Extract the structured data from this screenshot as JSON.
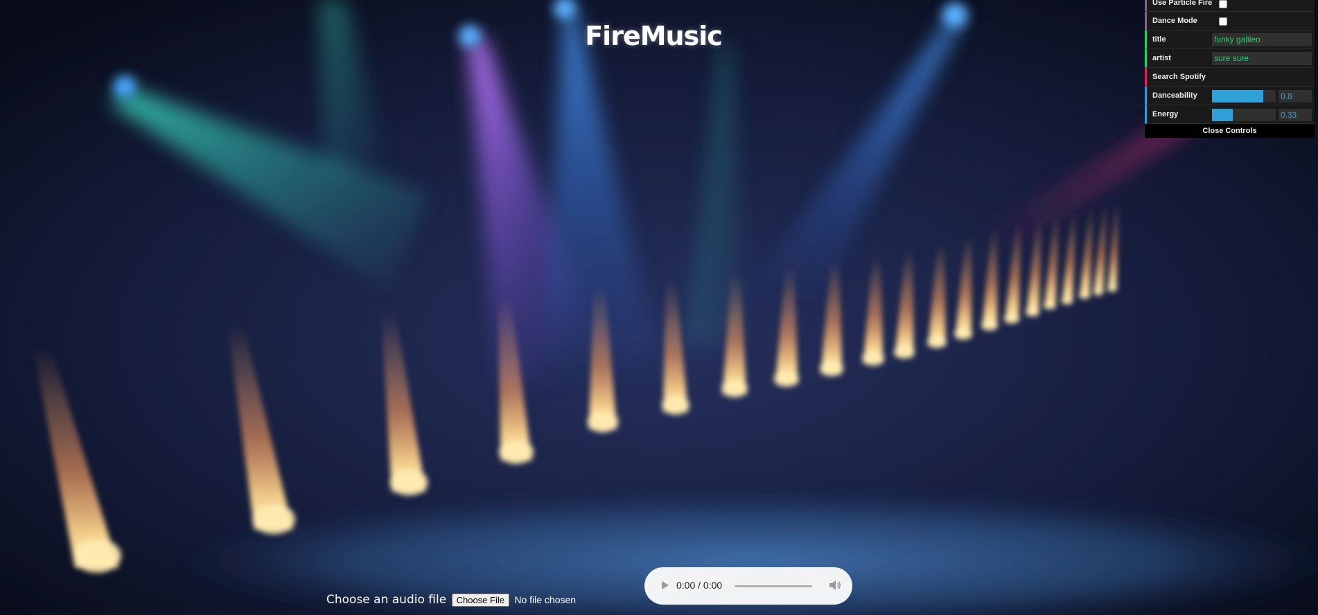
{
  "app": {
    "title": "FireMusic"
  },
  "controls": {
    "use_particle_fire": {
      "label": "Use Particle Fire",
      "checked": false
    },
    "dance_mode": {
      "label": "Dance Mode",
      "checked": false
    },
    "title": {
      "label": "title",
      "value": "funky galileo"
    },
    "artist": {
      "label": "artist",
      "value": "sure sure"
    },
    "search_spotify": {
      "label": "Search Spotify"
    },
    "danceability": {
      "label": "Danceability",
      "value": "0.8",
      "fraction": 0.8
    },
    "energy": {
      "label": "Energy",
      "value": "0.33",
      "fraction": 0.33
    },
    "close_label": "Close Controls"
  },
  "file_input": {
    "label": "Choose an audio file",
    "button_label": "Choose File",
    "status": "No file chosen"
  },
  "audio_player": {
    "time": "0:00 / 0:00"
  },
  "colors": {
    "string_accent": "#1ed36f",
    "number_accent": "#2fa1d6",
    "function_accent": "#e61d5f",
    "bool_accent": "#806787"
  }
}
